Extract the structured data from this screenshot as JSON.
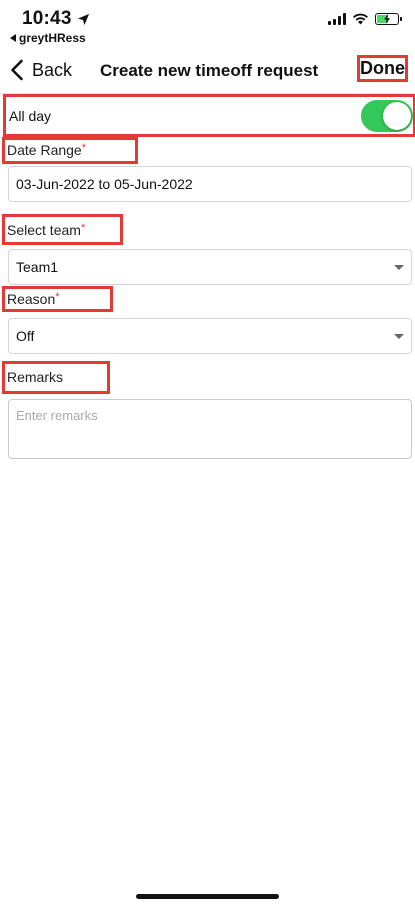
{
  "status_bar": {
    "time": "10:43",
    "back_app": "greytHRess",
    "battery_color": "#4cd964"
  },
  "nav": {
    "back_label": "Back",
    "title": "Create new timeoff request",
    "done_label": "Done"
  },
  "form": {
    "all_day": {
      "label": "All day",
      "enabled": true,
      "toggle_color": "#34c759"
    },
    "date_range": {
      "label": "Date Range",
      "required_mark": "*",
      "value": "03-Jun-2022 to 05-Jun-2022"
    },
    "team": {
      "label": "Select team",
      "required_mark": "*",
      "value": "Team1"
    },
    "reason": {
      "label": "Reason",
      "required_mark": "*",
      "value": "Off"
    },
    "remarks": {
      "label": "Remarks",
      "placeholder": "Enter remarks"
    }
  },
  "colors": {
    "annotation_red": "#e53935",
    "required_red": "#e53935"
  }
}
